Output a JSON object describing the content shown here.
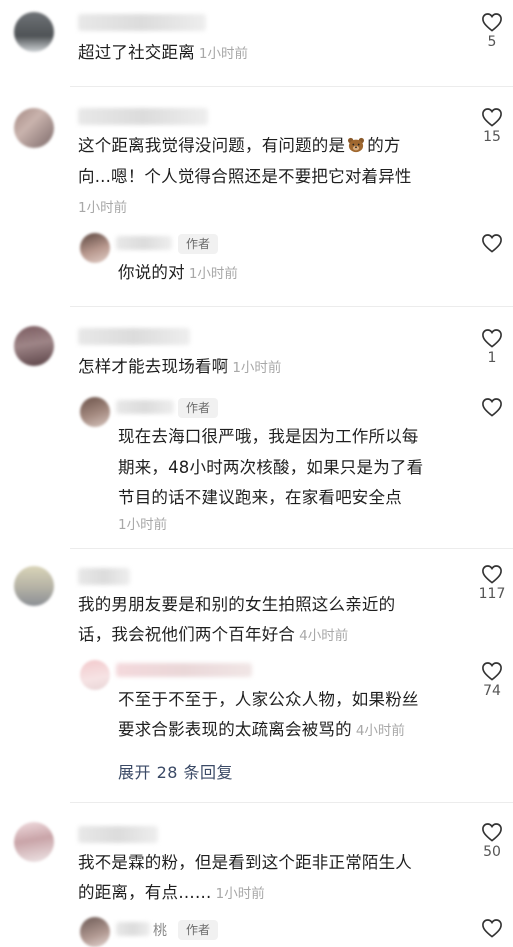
{
  "comments": [
    {
      "text": "超过了社交距离",
      "time": "1小时前",
      "likes": "5"
    },
    {
      "text_line1_a": "这个距离我觉得没问题，有问题的是",
      "text_line1_b": "的方",
      "text_line2": "向...嗯！个人觉得合照还是不要把它对着异性",
      "time": "1小时前",
      "likes": "15",
      "reply": {
        "tag": "作者",
        "text": "你说的对",
        "time": "1小时前"
      }
    },
    {
      "text": "怎样才能去现场看啊",
      "time": "1小时前",
      "likes": "1",
      "reply": {
        "tag": "作者",
        "line1": "现在去海口很严哦，我是因为工作所以每",
        "line2": "期来，48小时两次核酸，如果只是为了看",
        "line3": "节目的话不建议跑来，在家看吧安全点",
        "time": "1小时前"
      }
    },
    {
      "line1": "我的男朋友要是和别的女生拍照这么亲近的",
      "line2": "话，我会祝他们两个百年好合",
      "time": "4小时前",
      "likes": "117",
      "reply": {
        "line1": "不至于不至于，人家公众人物，如果粉丝",
        "line2": "要求合影表现的太疏离会被骂的",
        "time": "4小时前",
        "likes": "74"
      },
      "expand": "展开 28 条回复"
    },
    {
      "line1": "我不是霖的粉，但是看到这个距非正常陌生人",
      "line2": "的距离，有点……",
      "time": "1小时前",
      "likes": "50",
      "reply": {
        "name_fragment": "桃",
        "tag": "作者"
      }
    }
  ]
}
